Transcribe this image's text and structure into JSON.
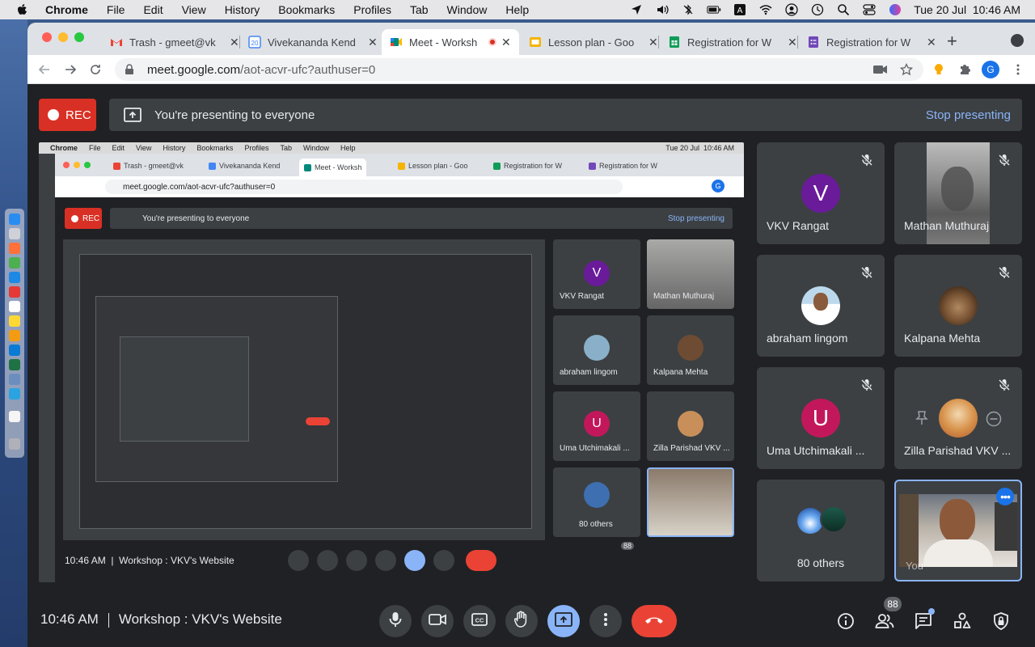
{
  "menubar": {
    "app": "Chrome",
    "items": [
      "File",
      "Edit",
      "View",
      "History",
      "Bookmarks",
      "Profiles",
      "Tab",
      "Window",
      "Help"
    ],
    "clock": "Tue 20 Jul  10:46 AM"
  },
  "tabs": [
    {
      "title": "Trash - gmeet@vk",
      "icon": "gmail-icon",
      "color": "#ea4335"
    },
    {
      "title": "Vivekananda Kend",
      "icon": "calendar-icon",
      "color": "#4285f4"
    },
    {
      "title": "Meet - Worksh",
      "icon": "meet-icon",
      "color": "#00897b",
      "active": true
    },
    {
      "title": "Lesson plan - Goo",
      "icon": "slides-icon",
      "color": "#f4b400"
    },
    {
      "title": "Registration for W",
      "icon": "sheets-icon",
      "color": "#0f9d58"
    },
    {
      "title": "Registration for W",
      "icon": "forms-icon",
      "color": "#7248b9"
    }
  ],
  "address": {
    "host": "meet.google.com",
    "path": "/aot-acvr-ufc?authuser=0"
  },
  "profile_initial": "G",
  "meet": {
    "rec_label": "REC",
    "presenting_text": "You're presenting to everyone",
    "stop_label": "Stop presenting",
    "time": "10:46 AM",
    "meeting_title": "Workshop : VKV's Website",
    "participant_count": "88",
    "participants": [
      {
        "name": "VKV Rangat",
        "initial": "V",
        "color": "#6a1b9a",
        "kind": "avatar"
      },
      {
        "name": "Mathan Muthuraj",
        "kind": "video"
      },
      {
        "name": "abraham lingom",
        "kind": "photo"
      },
      {
        "name": "Kalpana Mehta",
        "kind": "photo"
      },
      {
        "name": "Uma Utchimakali ...",
        "initial": "U",
        "color": "#c2185b",
        "kind": "avatar"
      },
      {
        "name": "Zilla Parishad VKV ...",
        "kind": "photo"
      },
      {
        "name": "80 others",
        "kind": "group"
      },
      {
        "name": "You",
        "kind": "self"
      }
    ]
  },
  "shared_screen": {
    "clock": "Tue 20 Jul  10:46 AM",
    "meeting_title": "Workshop : VKV's Website",
    "time": "10:46 AM",
    "address": "meet.google.com/aot-acvr-ufc?authuser=0",
    "participant_count": "88"
  }
}
